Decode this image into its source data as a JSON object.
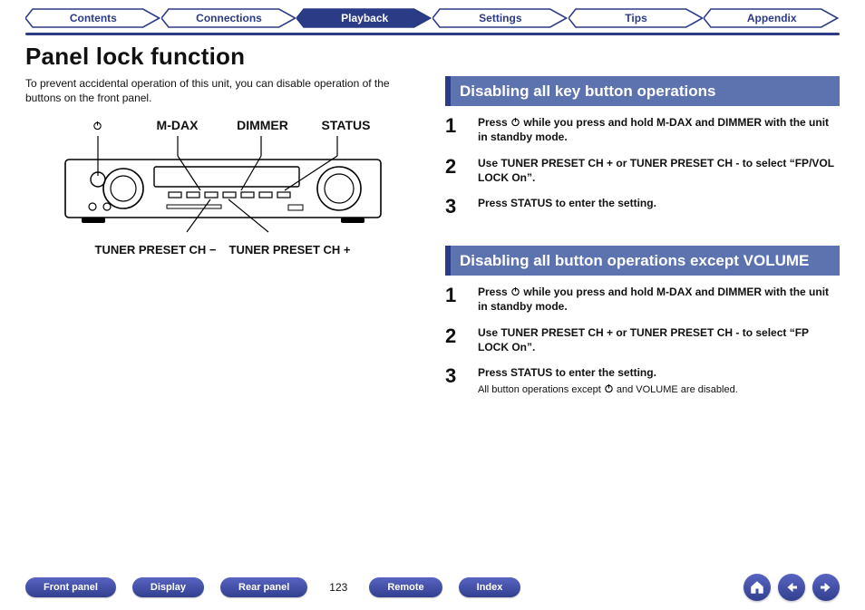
{
  "tabs": {
    "items": [
      {
        "label": "Contents"
      },
      {
        "label": "Connections"
      },
      {
        "label": "Playback",
        "active": true
      },
      {
        "label": "Settings"
      },
      {
        "label": "Tips"
      },
      {
        "label": "Appendix"
      }
    ]
  },
  "title": "Panel lock function",
  "intro": "To prevent accidental operation of this unit, you can disable operation of the buttons on the front panel.",
  "figure": {
    "top_labels": {
      "power": "⏻",
      "mdax": "M-DAX",
      "dimmer": "DIMMER",
      "status": "STATUS"
    },
    "bottom_labels": {
      "minus": "TUNER PRESET CH −",
      "plus": "TUNER PRESET CH +"
    }
  },
  "sections": [
    {
      "heading": "Disabling all key button operations",
      "steps": [
        {
          "num": "1",
          "pre": "Press ",
          "post": " while you press and hold M-DAX and DIMMER with the unit in standby mode."
        },
        {
          "num": "2",
          "text": "Use TUNER PRESET CH + or TUNER PRESET CH - to select “FP/VOL LOCK On”."
        },
        {
          "num": "3",
          "text": "Press STATUS to enter the setting."
        }
      ]
    },
    {
      "heading": "Disabling all button operations except VOLUME",
      "steps": [
        {
          "num": "1",
          "pre": "Press ",
          "post": " while you press and hold M-DAX and DIMMER with the unit in standby mode."
        },
        {
          "num": "2",
          "text": "Use TUNER PRESET CH + or TUNER PRESET CH - to select “FP LOCK On”."
        },
        {
          "num": "3",
          "text": "Press STATUS to enter the setting.",
          "note_pre": "All button operations except ",
          "note_post": " and VOLUME are disabled."
        }
      ]
    }
  ],
  "footer": {
    "pills": [
      {
        "label": "Front panel"
      },
      {
        "label": "Display"
      },
      {
        "label": "Rear panel"
      }
    ],
    "page": "123",
    "pills2": [
      {
        "label": "Remote"
      },
      {
        "label": "Index"
      }
    ]
  }
}
